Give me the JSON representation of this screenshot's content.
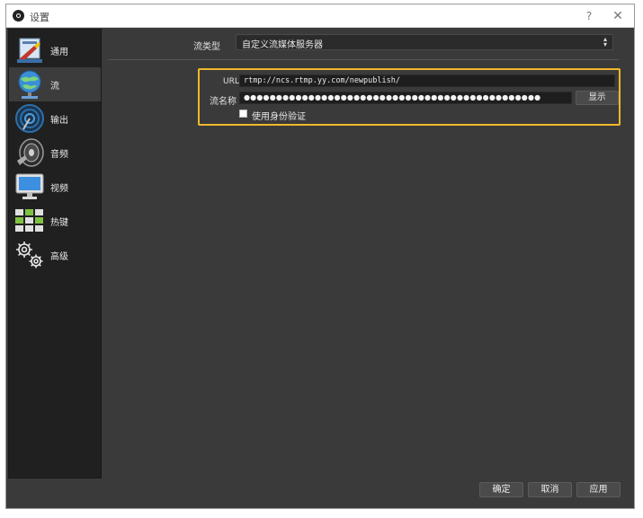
{
  "window": {
    "title": "设置",
    "help": "?",
    "close": "✕"
  },
  "sidebar": {
    "items": [
      {
        "label": "通用",
        "icon": "general-icon"
      },
      {
        "label": "流",
        "icon": "stream-globe-icon",
        "active": true
      },
      {
        "label": "输出",
        "icon": "output-icon"
      },
      {
        "label": "音频",
        "icon": "speaker-icon"
      },
      {
        "label": "视频",
        "icon": "monitor-icon"
      },
      {
        "label": "热键",
        "icon": "keyboard-icon"
      },
      {
        "label": "高级",
        "icon": "gears-icon"
      }
    ]
  },
  "stream": {
    "type_label": "流类型",
    "type_value": "自定义流媒体服务器",
    "url_label": "URL",
    "url_value": "rtmp://ncs.rtmp.yy.com/newpublish/",
    "key_label": "流名称",
    "key_value": "●●●●●●●●●●●●●●●●●●●●●●●●●●●●●●●●●●●●●●●●●●●●●●",
    "show_button": "显示",
    "auth_label": "使用身份验证",
    "auth_checked": false
  },
  "footer": {
    "ok": "确定",
    "cancel": "取消",
    "apply": "应用"
  },
  "colors": {
    "highlight": "#f0b92b",
    "background": "#3a3a3a",
    "sidebar": "#202020"
  }
}
